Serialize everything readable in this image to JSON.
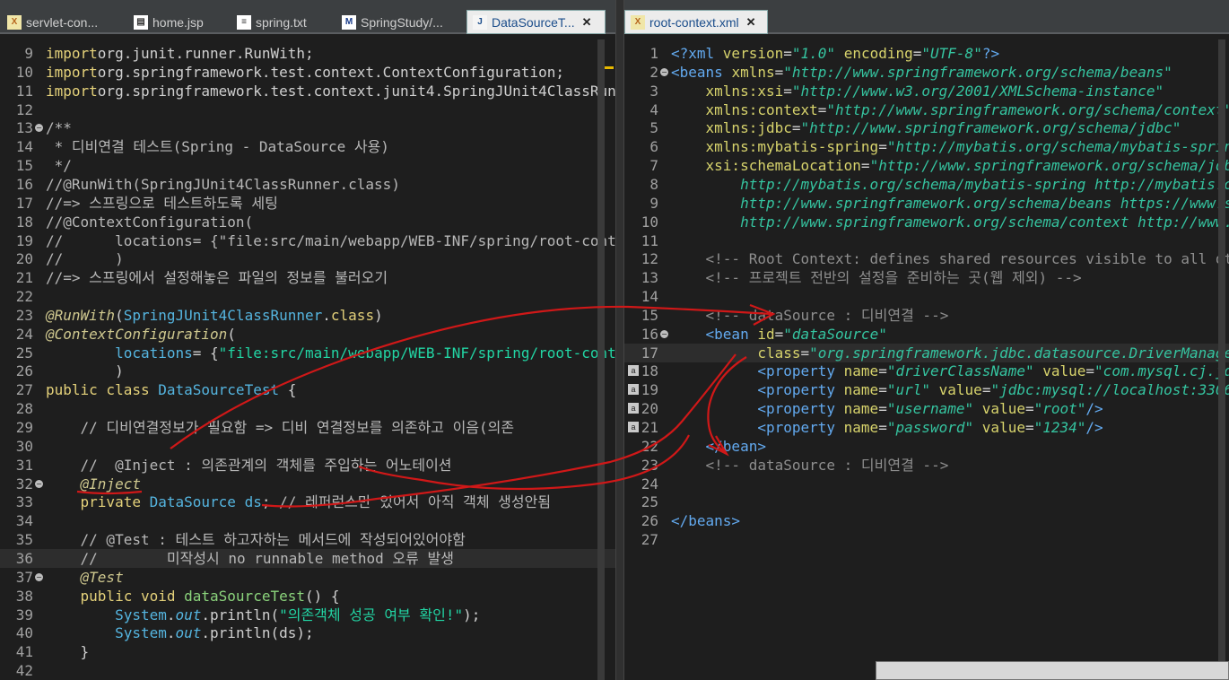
{
  "left_tabs": [
    {
      "label": "servlet-con...",
      "icon": "xml-file-icon"
    },
    {
      "label": "home.jsp",
      "icon": "jsp-file-icon"
    },
    {
      "label": "spring.txt",
      "icon": "text-file-icon"
    },
    {
      "label": "SpringStudy/...",
      "icon": "maven-file-icon"
    },
    {
      "label": "DataSourceT...",
      "icon": "java-file-icon",
      "active": true,
      "close": "✕"
    }
  ],
  "right_tabs": [
    {
      "label": "root-context.xml",
      "icon": "xml-file-icon",
      "active": true,
      "close": "✕"
    }
  ],
  "java_editor": {
    "lines": [
      {
        "n": "9",
        "segs": [
          [
            "kw",
            "import"
          ],
          [
            "",
            "org.junit.runner.RunWith;"
          ]
        ]
      },
      {
        "n": "10",
        "segs": [
          [
            "kw",
            "import"
          ],
          [
            "",
            "org.springframework.test.context.ContextConfiguration;"
          ]
        ]
      },
      {
        "n": "11",
        "segs": [
          [
            "kw",
            "import"
          ],
          [
            "",
            "org.springframework.test.context.junit4.SpringJUnit4ClassRun"
          ]
        ]
      },
      {
        "n": "12",
        "segs": []
      },
      {
        "n": "13",
        "fold": true,
        "segs": [
          [
            "cmt",
            "/**"
          ]
        ]
      },
      {
        "n": "14",
        "segs": [
          [
            "cmt",
            " * 디비연결 테스트(Spring - DataSource 사용)"
          ]
        ]
      },
      {
        "n": "15",
        "segs": [
          [
            "cmt",
            " */"
          ]
        ]
      },
      {
        "n": "16",
        "segs": [
          [
            "cmt",
            "//@RunWith(SpringJUnit4ClassRunner.class)"
          ]
        ]
      },
      {
        "n": "17",
        "segs": [
          [
            "cmt",
            "//=> 스프링으로 테스트하도록 세팅"
          ]
        ]
      },
      {
        "n": "18",
        "segs": [
          [
            "cmt",
            "//@ContextConfiguration("
          ]
        ]
      },
      {
        "n": "19",
        "segs": [
          [
            "cmt",
            "//      locations= {\"file:src/main/webapp/WEB-INF/spring/root-conte"
          ]
        ]
      },
      {
        "n": "20",
        "segs": [
          [
            "cmt",
            "//      )"
          ]
        ]
      },
      {
        "n": "21",
        "segs": [
          [
            "cmt",
            "//=> 스프링에서 설정해놓은 파일의 정보를 불러오기"
          ]
        ]
      },
      {
        "n": "22",
        "segs": []
      },
      {
        "n": "23",
        "segs": [
          [
            "ann",
            "@RunWith"
          ],
          [
            "",
            "("
          ],
          [
            "cls",
            "SpringJUnit4ClassRunner"
          ],
          [
            "",
            "."
          ],
          [
            "kw",
            "class"
          ],
          [
            "",
            ")"
          ]
        ]
      },
      {
        "n": "24",
        "segs": [
          [
            "ann",
            "@ContextConfiguration"
          ],
          [
            "",
            "("
          ]
        ]
      },
      {
        "n": "25",
        "segs": [
          [
            "",
            "        "
          ],
          [
            "cls",
            "locations"
          ],
          [
            "",
            "= {"
          ],
          [
            "str",
            "\"file:src/main/webapp/WEB-INF/spring/root-conte"
          ]
        ]
      },
      {
        "n": "26",
        "segs": [
          [
            "",
            "        )"
          ]
        ]
      },
      {
        "n": "27",
        "segs": [
          [
            "kw",
            "public class "
          ],
          [
            "cls",
            "DataSourceTest"
          ],
          [
            "",
            " {"
          ]
        ]
      },
      {
        "n": "28",
        "segs": []
      },
      {
        "n": "29",
        "segs": [
          [
            "cmt",
            "    // 디비연결정보가 필요함 => 디비 연결정보를 의존하고 이음(의존"
          ]
        ]
      },
      {
        "n": "30",
        "segs": []
      },
      {
        "n": "31",
        "segs": [
          [
            "cmt",
            "    //  @Inject : 의존관계의 객체를 주입하는 어노테이션"
          ]
        ]
      },
      {
        "n": "32",
        "fold": true,
        "segs": [
          [
            "ann",
            "    @Inject"
          ]
        ]
      },
      {
        "n": "33",
        "segs": [
          [
            "kw",
            "    private "
          ],
          [
            "cls",
            "DataSource"
          ],
          [
            "",
            " "
          ],
          [
            "cls",
            "ds"
          ],
          [
            "",
            ";"
          ],
          [
            "cmt",
            " // 레퍼런스만 있어서 아직 객체 생성안됨"
          ]
        ]
      },
      {
        "n": "34",
        "segs": []
      },
      {
        "n": "35",
        "segs": [
          [
            "cmt",
            "    // @Test : 테스트 하고자하는 메서드에 작성되어있어야함"
          ]
        ]
      },
      {
        "n": "36",
        "hl": true,
        "segs": [
          [
            "cmt",
            "    //        미작성시 no runnable method 오류 발생"
          ]
        ]
      },
      {
        "n": "37",
        "fold": true,
        "segs": [
          [
            "ann",
            "    @Test"
          ]
        ]
      },
      {
        "n": "38",
        "segs": [
          [
            "kw",
            "    public void "
          ],
          [
            "meth",
            "dataSourceTest"
          ],
          [
            "",
            "() {"
          ]
        ]
      },
      {
        "n": "39",
        "segs": [
          [
            "cls",
            "        System"
          ],
          [
            "",
            "."
          ],
          [
            "cls ital",
            "out"
          ],
          [
            "",
            ".println("
          ],
          [
            "str",
            "\"의존객체 성공 여부 확인!\""
          ],
          [
            "",
            ");"
          ]
        ]
      },
      {
        "n": "40",
        "segs": [
          [
            "cls",
            "        System"
          ],
          [
            "",
            "."
          ],
          [
            "cls ital",
            "out"
          ],
          [
            "",
            ".println(ds);"
          ]
        ]
      },
      {
        "n": "41",
        "segs": [
          [
            "",
            "    }"
          ]
        ]
      },
      {
        "n": "42",
        "segs": []
      }
    ]
  },
  "xml_editor": {
    "lines": [
      {
        "n": "1",
        "segs": [
          [
            "xtag",
            "<?xml "
          ],
          [
            "xattr",
            "version"
          ],
          [
            "",
            "="
          ],
          [
            "xval",
            "\"1.0\""
          ],
          [
            "",
            " "
          ],
          [
            "xattr",
            "encoding"
          ],
          [
            "",
            "="
          ],
          [
            "xval",
            "\"UTF-8\""
          ],
          [
            "xtag",
            "?>"
          ]
        ]
      },
      {
        "n": "2",
        "fold": true,
        "segs": [
          [
            "xtag",
            "<beans "
          ],
          [
            "xattr",
            "xmlns"
          ],
          [
            "",
            "="
          ],
          [
            "xval",
            "\"http://www.springframework.org/schema/beans\""
          ]
        ]
      },
      {
        "n": "3",
        "segs": [
          [
            "",
            "    "
          ],
          [
            "xattr",
            "xmlns:xsi"
          ],
          [
            "",
            "="
          ],
          [
            "xval",
            "\"http://www.w3.org/2001/XMLSchema-instance\""
          ]
        ]
      },
      {
        "n": "4",
        "segs": [
          [
            "",
            "    "
          ],
          [
            "xattr",
            "xmlns:context"
          ],
          [
            "",
            "="
          ],
          [
            "xval",
            "\"http://www.springframework.org/schema/context\""
          ]
        ]
      },
      {
        "n": "5",
        "segs": [
          [
            "",
            "    "
          ],
          [
            "xattr",
            "xmlns:jdbc"
          ],
          [
            "",
            "="
          ],
          [
            "xval",
            "\"http://www.springframework.org/schema/jdbc\""
          ]
        ]
      },
      {
        "n": "6",
        "segs": [
          [
            "",
            "    "
          ],
          [
            "xattr",
            "xmlns:mybatis-spring"
          ],
          [
            "",
            "="
          ],
          [
            "xval",
            "\"http://mybatis.org/schema/mybatis-spring"
          ]
        ]
      },
      {
        "n": "7",
        "segs": [
          [
            "",
            "    "
          ],
          [
            "xattr",
            "xsi:schemaLocation"
          ],
          [
            "",
            "="
          ],
          [
            "xval",
            "\"http://www.springframework.org/schema/jdbc"
          ]
        ]
      },
      {
        "n": "8",
        "segs": [
          [
            "xval",
            "        http://mybatis.org/schema/mybatis-spring http://mybatis.or"
          ]
        ]
      },
      {
        "n": "9",
        "segs": [
          [
            "xval",
            "        http://www.springframework.org/schema/beans https://www.sp"
          ]
        ]
      },
      {
        "n": "10",
        "segs": [
          [
            "xval",
            "        http://www.springframework.org/schema/context http://www.s"
          ]
        ]
      },
      {
        "n": "11",
        "segs": []
      },
      {
        "n": "12",
        "segs": [
          [
            "xcmt",
            "    <!-- Root Context: defines shared resources visible to all oth"
          ]
        ]
      },
      {
        "n": "13",
        "segs": [
          [
            "xcmt",
            "    <!-- 프로젝트 전반의 설정을 준비하는 곳(웹 제외) -->"
          ]
        ]
      },
      {
        "n": "14",
        "segs": []
      },
      {
        "n": "15",
        "segs": [
          [
            "xcmt",
            "    <!-- dataSource : 디비연결 -->"
          ]
        ]
      },
      {
        "n": "16",
        "fold": true,
        "segs": [
          [
            "xtag",
            "    <bean "
          ],
          [
            "xattr",
            "id"
          ],
          [
            "",
            "="
          ],
          [
            "xval",
            "\"dataSource\""
          ]
        ]
      },
      {
        "n": "17",
        "hl": true,
        "segs": [
          [
            "",
            "          "
          ],
          [
            "xattr",
            "class"
          ],
          [
            "",
            "="
          ],
          [
            "xval",
            "\"org.springframework.jdbc.datasource.DriverManager"
          ]
        ]
      },
      {
        "n": "18",
        "marker": "a",
        "segs": [
          [
            "xtag",
            "          <property "
          ],
          [
            "xattr",
            "name"
          ],
          [
            "",
            "="
          ],
          [
            "xval",
            "\"driverClassName\""
          ],
          [
            "",
            " "
          ],
          [
            "xattr",
            "value"
          ],
          [
            "",
            "="
          ],
          [
            "xval",
            "\"com.mysql.cj.jdb"
          ]
        ]
      },
      {
        "n": "19",
        "marker": "a",
        "segs": [
          [
            "xtag",
            "          <property "
          ],
          [
            "xattr",
            "name"
          ],
          [
            "",
            "="
          ],
          [
            "xval",
            "\"url\""
          ],
          [
            "",
            " "
          ],
          [
            "xattr",
            "value"
          ],
          [
            "",
            "="
          ],
          [
            "xval",
            "\"jdbc:mysql://localhost:3306/"
          ]
        ]
      },
      {
        "n": "20",
        "marker": "a",
        "segs": [
          [
            "xtag",
            "          <property "
          ],
          [
            "xattr",
            "name"
          ],
          [
            "",
            "="
          ],
          [
            "xval",
            "\"username\""
          ],
          [
            "",
            " "
          ],
          [
            "xattr",
            "value"
          ],
          [
            "",
            "="
          ],
          [
            "xval",
            "\"root\""
          ],
          [
            "xtag",
            "/>"
          ]
        ]
      },
      {
        "n": "21",
        "marker": "a",
        "segs": [
          [
            "xtag",
            "          <property "
          ],
          [
            "xattr",
            "name"
          ],
          [
            "",
            "="
          ],
          [
            "xval",
            "\"password\""
          ],
          [
            "",
            " "
          ],
          [
            "xattr",
            "value"
          ],
          [
            "",
            "="
          ],
          [
            "xval",
            "\"1234\""
          ],
          [
            "xtag",
            "/>"
          ]
        ]
      },
      {
        "n": "22",
        "segs": [
          [
            "xtag",
            "    </bean>"
          ]
        ]
      },
      {
        "n": "23",
        "segs": [
          [
            "xcmt",
            "    <!-- dataSource : 디비연결 -->"
          ]
        ]
      },
      {
        "n": "24",
        "segs": []
      },
      {
        "n": "25",
        "segs": []
      },
      {
        "n": "26",
        "segs": [
          [
            "xtag",
            "</beans>"
          ]
        ]
      },
      {
        "n": "27",
        "segs": []
      }
    ]
  },
  "colors": {
    "annotation_ink": "#d01818",
    "editor_bg": "#1e1e1e",
    "tab_active_bg": "#ececec"
  }
}
